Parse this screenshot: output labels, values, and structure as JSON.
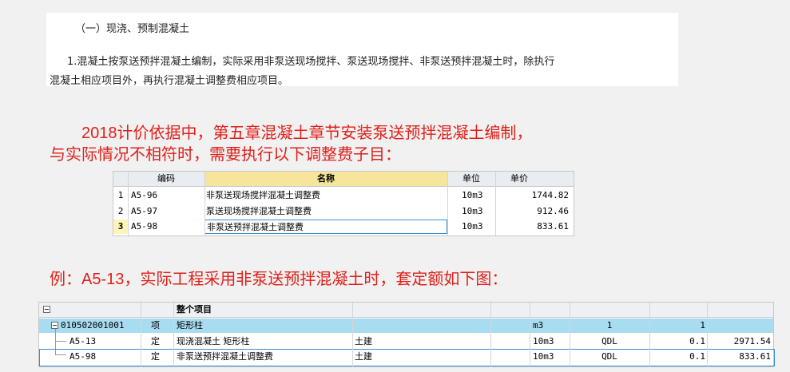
{
  "document": {
    "heading": "（一）现浇、预制混凝土",
    "line1": "1.混凝土按泵送预拌混凝土编制，实际采用非泵送现场搅拌、泵送现场搅拌、非泵送预拌混凝土时，除执行",
    "line2": "混凝土相应项目外，再执行混凝土调整费相应项目。"
  },
  "notes": {
    "line1": "2018计价依据中，第五章混凝土章节安装泵送预拌混凝土编制，",
    "line2": "与实际情况不相符时，需要执行以下调整费子目：",
    "example": "例：A5-13，实际工程采用非泵送预拌混凝土时，套定额如下图："
  },
  "adjust_table": {
    "headers": [
      "编码",
      "名称",
      "单位",
      "单价"
    ],
    "rows": [
      {
        "num": "1",
        "code": "A5-96",
        "name": "非泵送现场搅拌混凝土调整费",
        "unit": "10m3",
        "price": "1744.82"
      },
      {
        "num": "2",
        "code": "A5-97",
        "name": "泵送现场搅拌混凝土调整费",
        "unit": "10m3",
        "price": "912.46"
      },
      {
        "num": "3",
        "code": "A5-98",
        "name": "非泵送预拌混凝土调整费",
        "unit": "10m3",
        "price": "833.61"
      }
    ]
  },
  "quota_table": {
    "header": "整个项目",
    "rows": [
      {
        "code": "010502001001",
        "type": "项",
        "name": "矩形柱",
        "discipline": "",
        "unit": "m3",
        "qty_expr": "1",
        "qty": "1",
        "total": ""
      },
      {
        "code": "A5-13",
        "type": "定",
        "name": "现浇混凝土 矩形柱",
        "discipline": "土建",
        "unit": "10m3",
        "qty_expr": "QDL",
        "qty": "0.1",
        "total": "2971.54"
      },
      {
        "code": "A5-98",
        "type": "定",
        "name": "非泵送预拌混凝土调整费",
        "discipline": "土建",
        "unit": "10m3",
        "qty_expr": "QDL",
        "qty": "0.1",
        "total": "833.61"
      }
    ]
  }
}
